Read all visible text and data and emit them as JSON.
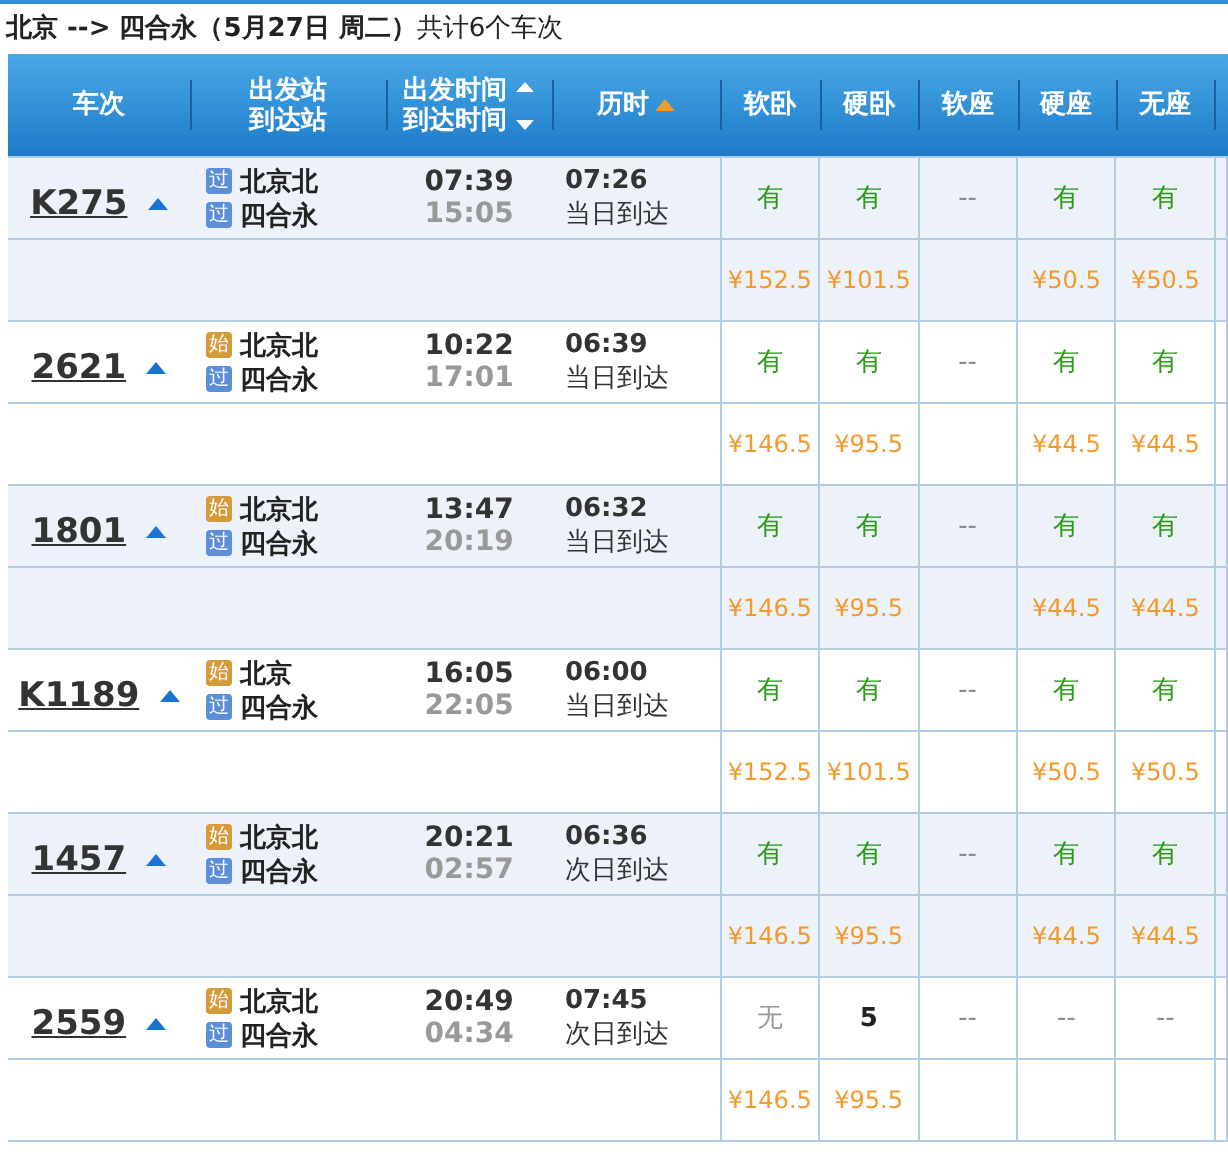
{
  "summary": "**北京 --> 四合永（5月27日  周二）**共计6个车次",
  "columns": [
    {
      "label": "车次"
    },
    {
      "label": "出发站",
      "label2": "到达站"
    },
    {
      "label": "出发时间",
      "label2": "到达时间",
      "kind": "sortboth"
    },
    {
      "label": "历时",
      "kind": "sortup"
    },
    {
      "label": "软卧"
    },
    {
      "label": "硬卧"
    },
    {
      "label": "软座"
    },
    {
      "label": "硬座"
    },
    {
      "label": "无座"
    }
  ],
  "trains": [
    {
      "number": "K275",
      "from": {
        "badge": "过",
        "kind": "pass",
        "name": "北京北"
      },
      "to": {
        "badge": "过",
        "kind": "pass",
        "name": "四合永"
      },
      "depart": "07:39",
      "arrive": "15:05",
      "duration": "07:26",
      "arrival_day": "当日到达",
      "seats": [
        {
          "kind": "yes",
          "text": "有",
          "price": "¥152.5"
        },
        {
          "kind": "yes",
          "text": "有",
          "price": "¥101.5"
        },
        {
          "kind": "na",
          "text": "--"
        },
        {
          "kind": "yes",
          "text": "有",
          "price": "¥50.5"
        },
        {
          "kind": "yes",
          "text": "有",
          "price": "¥50.5"
        }
      ]
    },
    {
      "number": "2621",
      "from": {
        "badge": "始",
        "kind": "origin",
        "name": "北京北"
      },
      "to": {
        "badge": "过",
        "kind": "pass",
        "name": "四合永"
      },
      "depart": "10:22",
      "arrive": "17:01",
      "duration": "06:39",
      "arrival_day": "当日到达",
      "seats": [
        {
          "kind": "yes",
          "text": "有",
          "price": "¥146.5"
        },
        {
          "kind": "yes",
          "text": "有",
          "price": "¥95.5"
        },
        {
          "kind": "na",
          "text": "--"
        },
        {
          "kind": "yes",
          "text": "有",
          "price": "¥44.5"
        },
        {
          "kind": "yes",
          "text": "有",
          "price": "¥44.5"
        }
      ]
    },
    {
      "number": "1801",
      "from": {
        "badge": "始",
        "kind": "origin",
        "name": "北京北"
      },
      "to": {
        "badge": "过",
        "kind": "pass",
        "name": "四合永"
      },
      "depart": "13:47",
      "arrive": "20:19",
      "duration": "06:32",
      "arrival_day": "当日到达",
      "seats": [
        {
          "kind": "yes",
          "text": "有",
          "price": "¥146.5"
        },
        {
          "kind": "yes",
          "text": "有",
          "price": "¥95.5"
        },
        {
          "kind": "na",
          "text": "--"
        },
        {
          "kind": "yes",
          "text": "有",
          "price": "¥44.5"
        },
        {
          "kind": "yes",
          "text": "有",
          "price": "¥44.5"
        }
      ]
    },
    {
      "number": "K1189",
      "from": {
        "badge": "始",
        "kind": "origin",
        "name": "北京"
      },
      "to": {
        "badge": "过",
        "kind": "pass",
        "name": "四合永"
      },
      "depart": "16:05",
      "arrive": "22:05",
      "duration": "06:00",
      "arrival_day": "当日到达",
      "seats": [
        {
          "kind": "yes",
          "text": "有",
          "price": "¥152.5"
        },
        {
          "kind": "yes",
          "text": "有",
          "price": "¥101.5"
        },
        {
          "kind": "na",
          "text": "--"
        },
        {
          "kind": "yes",
          "text": "有",
          "price": "¥50.5"
        },
        {
          "kind": "yes",
          "text": "有",
          "price": "¥50.5"
        }
      ]
    },
    {
      "number": "1457",
      "from": {
        "badge": "始",
        "kind": "origin",
        "name": "北京北"
      },
      "to": {
        "badge": "过",
        "kind": "pass",
        "name": "四合永"
      },
      "depart": "20:21",
      "arrive": "02:57",
      "duration": "06:36",
      "arrival_day": "次日到达",
      "seats": [
        {
          "kind": "yes",
          "text": "有",
          "price": "¥146.5"
        },
        {
          "kind": "yes",
          "text": "有",
          "price": "¥95.5"
        },
        {
          "kind": "na",
          "text": "--"
        },
        {
          "kind": "yes",
          "text": "有",
          "price": "¥44.5"
        },
        {
          "kind": "yes",
          "text": "有",
          "price": "¥44.5"
        }
      ]
    },
    {
      "number": "2559",
      "from": {
        "badge": "始",
        "kind": "origin",
        "name": "北京北"
      },
      "to": {
        "badge": "过",
        "kind": "pass",
        "name": "四合永"
      },
      "depart": "20:49",
      "arrive": "04:34",
      "duration": "07:45",
      "arrival_day": "次日到达",
      "seats": [
        {
          "kind": "none",
          "text": "无",
          "price": "¥146.5"
        },
        {
          "kind": "count",
          "text": "5",
          "price": "¥95.5"
        },
        {
          "kind": "na",
          "text": "--"
        },
        {
          "kind": "na",
          "text": "--"
        },
        {
          "kind": "na",
          "text": "--"
        }
      ]
    }
  ]
}
